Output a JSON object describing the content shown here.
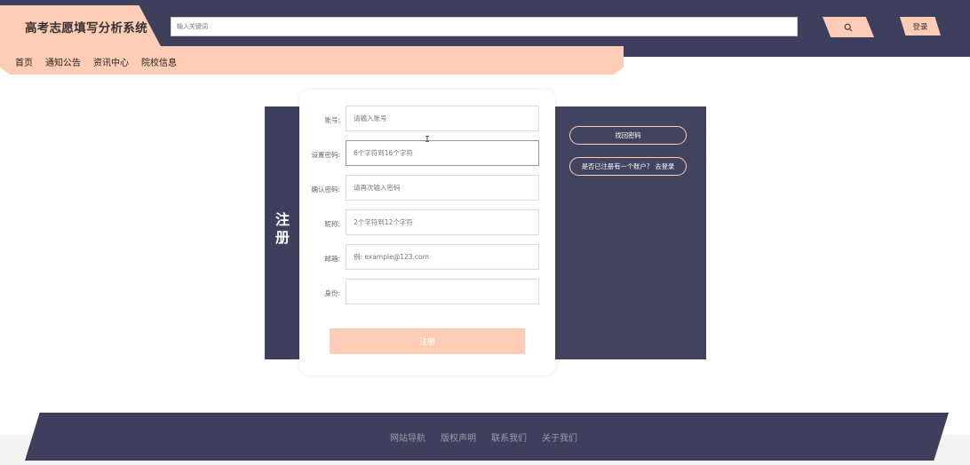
{
  "header": {
    "brand": "高考志愿填写分析系统",
    "search_placeholder": "输入关键词",
    "login_label": "登录",
    "nav": [
      "首页",
      "通知公告",
      "资讯中心",
      "院校信息"
    ]
  },
  "register": {
    "title": "注册",
    "fields": [
      {
        "label": "账号:",
        "placeholder": "请输入账号"
      },
      {
        "label": "设置密码:",
        "placeholder": "6个字符到16个字符"
      },
      {
        "label": "确认密码:",
        "placeholder": "请再次输入密码"
      },
      {
        "label": "昵称:",
        "placeholder": "2个字符到12个字符"
      },
      {
        "label": "邮箱:",
        "placeholder": "例: example@123.com"
      },
      {
        "label": "身份:",
        "placeholder": ""
      }
    ],
    "submit_label": "注册",
    "retrieve_password": "找回密码",
    "has_account": "是否已注册有一个账户？ 去登录"
  },
  "footer": {
    "links": [
      "网站导航",
      "版权声明",
      "联系我们",
      "关于我们"
    ]
  },
  "colors": {
    "navy": "#3d3f5d",
    "peach": "#ffcdb6"
  },
  "icons": {
    "search": "search-icon",
    "cursor": "text-cursor-icon"
  }
}
